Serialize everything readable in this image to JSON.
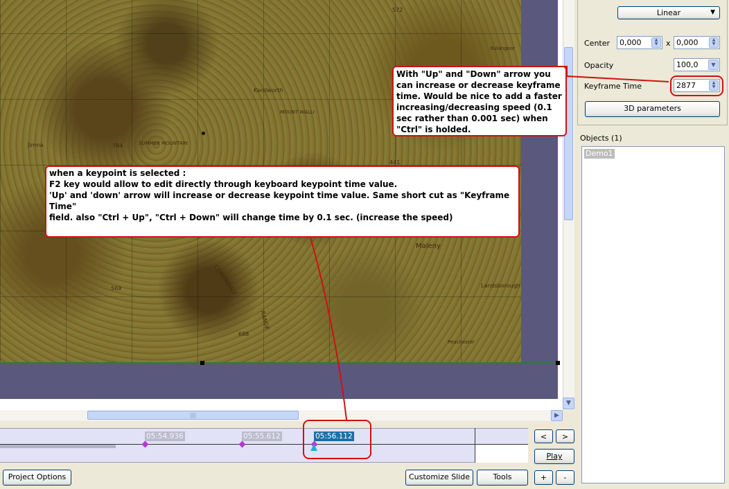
{
  "map": {
    "place_names": [
      "Kenilworth",
      "Jimna",
      "SUMMER MOUNTAIN",
      "784",
      "MOUNT WALLI",
      "Maleny",
      "CONONDALE",
      "RANGE",
      "Landsborough",
      "Peachester",
      "Kulangoor",
      "569",
      "688",
      "441",
      "572"
    ]
  },
  "panel": {
    "interpolation_value": "Linear",
    "center_label": "Center",
    "center_x": "0,000",
    "center_sep": "x",
    "center_y": "0,000",
    "opacity_label": "Opacity",
    "opacity_value": "100,0",
    "keyframe_time_label": "Keyframe Time",
    "keyframe_time_value": "2877",
    "params_button": "3D parameters",
    "objects_header": "Objects (1)",
    "objects": [
      "Demo1"
    ]
  },
  "timeline": {
    "keypoints": [
      {
        "label": "05:54.936",
        "selected": false
      },
      {
        "label": "05:55.612",
        "selected": false
      },
      {
        "label": "05:56.112",
        "selected": true
      }
    ]
  },
  "nav": {
    "prev": "<",
    "next": ">",
    "play": "Play",
    "plus": "+",
    "minus": "-"
  },
  "bottom": {
    "project_options": "Project Options",
    "customize_slide": "Customize Slide",
    "tools": "Tools"
  },
  "annotations": {
    "keyframe_note": "With \"Up\" and \"Down\" arrow you can increase or decrease keyframe time. Would be nice to add a faster increasing/decreasing speed (0.1 sec rather than 0.001 sec) when \"Ctrl\" is holded.",
    "keypoint_note_lines": [
      "when a keypoint is selected :",
      " F2 key would allow to edit directly through keyboard keypoint time value.",
      " 'Up' and 'down' arrow will increase or decrease keypoint time value. Same short cut as \"Keyframe Time\"",
      "field. also \"Ctrl + Up\", \"Ctrl + Down\" will change time by 0.1 sec. (increase the speed)"
    ]
  },
  "colors": {
    "annotation_red": "#d01010",
    "keypoint_purple": "#b23ad0",
    "selected_blue": "#1c6fa8",
    "timeline_bg": "#e2e2f6",
    "dim_overlay": "#5b587e"
  }
}
